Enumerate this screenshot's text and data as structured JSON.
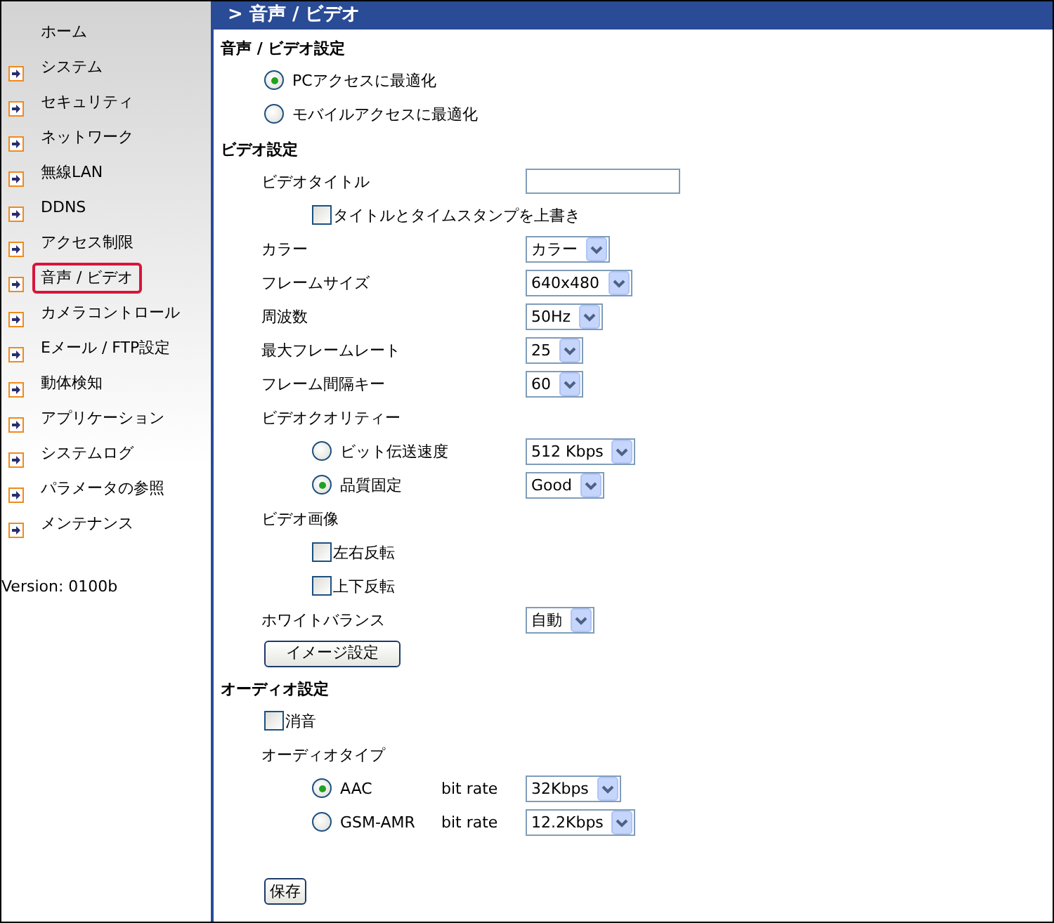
{
  "sidebar": {
    "items": [
      {
        "label": "ホーム",
        "arrow": false,
        "selected": false
      },
      {
        "label": "システム",
        "arrow": true,
        "selected": false
      },
      {
        "label": "セキュリティ",
        "arrow": true,
        "selected": false
      },
      {
        "label": "ネットワーク",
        "arrow": true,
        "selected": false
      },
      {
        "label": "無線LAN",
        "arrow": true,
        "selected": false
      },
      {
        "label": "DDNS",
        "arrow": true,
        "selected": false
      },
      {
        "label": "アクセス制限",
        "arrow": true,
        "selected": false
      },
      {
        "label": "音声 / ビデオ",
        "arrow": true,
        "selected": true
      },
      {
        "label": "カメラコントロール",
        "arrow": true,
        "selected": false
      },
      {
        "label": "Eメール / FTP設定",
        "arrow": true,
        "selected": false
      },
      {
        "label": "動体検知",
        "arrow": true,
        "selected": false
      },
      {
        "label": "アプリケーション",
        "arrow": true,
        "selected": false
      },
      {
        "label": "システムログ",
        "arrow": true,
        "selected": false
      },
      {
        "label": "パラメータの参照",
        "arrow": true,
        "selected": false
      },
      {
        "label": "メンテナンス",
        "arrow": true,
        "selected": false
      }
    ],
    "version": "Version: 0100b"
  },
  "header": {
    "title": "> 音声 / ビデオ"
  },
  "sections": [
    {
      "title": "音声 / ビデオ設定",
      "rows": [
        {
          "kind": "radio",
          "label": "PCアクセスに最適化",
          "selected": true
        },
        {
          "kind": "radio",
          "label": "モバイルアクセスに最適化",
          "selected": false
        }
      ]
    },
    {
      "title": "ビデオ設定",
      "rows": [
        {
          "kind": "text-field",
          "label": "ビデオタイトル",
          "children": [
            {
              "kind": "checkbox",
              "label": "タイトルとタイムスタンプを上書き",
              "checked": false
            }
          ]
        },
        {
          "kind": "select",
          "label": "カラー",
          "value": "カラー"
        },
        {
          "kind": "select",
          "label": "フレームサイズ",
          "value": "640x480"
        },
        {
          "kind": "select",
          "label": "周波数",
          "value": "50Hz"
        },
        {
          "kind": "select",
          "label": "最大フレームレート",
          "value": "25"
        },
        {
          "kind": "select",
          "label": "フレーム間隔キー",
          "value": "60"
        },
        {
          "kind": "label",
          "label": "ビデオクオリティー",
          "children": [
            {
              "kind": "radio",
              "label": "ビット伝送速度",
              "selected": false,
              "value": "512 Kbps"
            },
            {
              "kind": "radio",
              "label": "品質固定",
              "selected": true,
              "value": "Good"
            }
          ]
        },
        {
          "kind": "label",
          "label": "ビデオ画像",
          "children": [
            {
              "kind": "checkbox",
              "label": "左右反転",
              "checked": false
            },
            {
              "kind": "checkbox",
              "label": "上下反転",
              "checked": false
            }
          ]
        },
        {
          "kind": "select",
          "label": "ホワイトバランス",
          "value": "自動"
        },
        {
          "kind": "button",
          "label": "イメージ設定"
        }
      ]
    },
    {
      "title": "オーディオ設定",
      "rows": [
        {
          "kind": "checkbox",
          "label": "消音",
          "checked": false
        },
        {
          "kind": "label",
          "label": "オーディオタイプ",
          "children": [
            {
              "kind": "radio",
              "label": "AAC",
              "selected": true,
              "rate_label": "bit rate",
              "value": "32Kbps"
            },
            {
              "kind": "radio",
              "label": "GSM-AMR",
              "selected": false,
              "rate_label": "bit rate",
              "value": "12.2Kbps"
            }
          ]
        }
      ]
    }
  ],
  "save_button": "保存"
}
